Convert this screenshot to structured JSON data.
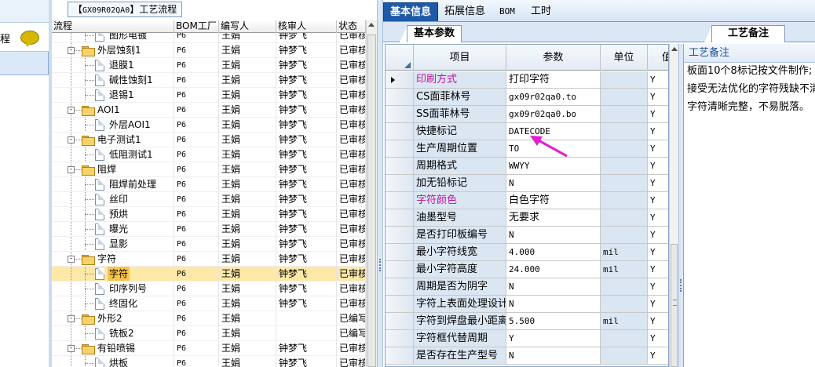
{
  "left_stub": {
    "label": "程"
  },
  "tree": {
    "title_prefix": "【",
    "title_code": "GX09R02QA0",
    "title_suffix": "】工艺流程",
    "columns": [
      "流程",
      "BOM工厂",
      "编写人",
      "核审人",
      "状态"
    ],
    "rows": [
      {
        "name": "图形电镀",
        "bom": "P6",
        "writer": "王娟",
        "reviewer": "钟梦飞",
        "status": "已审核",
        "level": 2,
        "type": "doc"
      },
      {
        "name": "外层蚀刻1",
        "bom": "P6",
        "writer": "王娟",
        "reviewer": "钟梦飞",
        "status": "已审核",
        "level": 1,
        "type": "folder"
      },
      {
        "name": "退膜1",
        "bom": "P6",
        "writer": "王娟",
        "reviewer": "钟梦飞",
        "status": "已审核",
        "level": 2,
        "type": "doc"
      },
      {
        "name": "碱性蚀刻1",
        "bom": "P6",
        "writer": "王娟",
        "reviewer": "钟梦飞",
        "status": "已审核",
        "level": 2,
        "type": "doc"
      },
      {
        "name": "退锡1",
        "bom": "P6",
        "writer": "王娟",
        "reviewer": "钟梦飞",
        "status": "已审核",
        "level": 2,
        "type": "doc"
      },
      {
        "name": "AOI1",
        "bom": "P6",
        "writer": "王娟",
        "reviewer": "钟梦飞",
        "status": "已审核",
        "level": 1,
        "type": "folder"
      },
      {
        "name": "外层AOI1",
        "bom": "P6",
        "writer": "王娟",
        "reviewer": "钟梦飞",
        "status": "已审核",
        "level": 2,
        "type": "doc"
      },
      {
        "name": "电子测试1",
        "bom": "P6",
        "writer": "王娟",
        "reviewer": "钟梦飞",
        "status": "已审核",
        "level": 1,
        "type": "folder"
      },
      {
        "name": "低阻测试1",
        "bom": "P6",
        "writer": "王娟",
        "reviewer": "钟梦飞",
        "status": "已审核",
        "level": 2,
        "type": "doc"
      },
      {
        "name": "阻焊",
        "bom": "P6",
        "writer": "王娟",
        "reviewer": "钟梦飞",
        "status": "已审核",
        "level": 1,
        "type": "folder"
      },
      {
        "name": "阻焊前处理",
        "bom": "P6",
        "writer": "王娟",
        "reviewer": "钟梦飞",
        "status": "已审核",
        "level": 2,
        "type": "doc"
      },
      {
        "name": "丝印",
        "bom": "P6",
        "writer": "王娟",
        "reviewer": "钟梦飞",
        "status": "已审核",
        "level": 2,
        "type": "doc"
      },
      {
        "name": "预烘",
        "bom": "P6",
        "writer": "王娟",
        "reviewer": "钟梦飞",
        "status": "已审核",
        "level": 2,
        "type": "doc"
      },
      {
        "name": "曝光",
        "bom": "P6",
        "writer": "王娟",
        "reviewer": "钟梦飞",
        "status": "已审核",
        "level": 2,
        "type": "doc"
      },
      {
        "name": "显影",
        "bom": "P6",
        "writer": "王娟",
        "reviewer": "钟梦飞",
        "status": "已审核",
        "level": 2,
        "type": "doc"
      },
      {
        "name": "字符",
        "bom": "P6",
        "writer": "王娟",
        "reviewer": "钟梦飞",
        "status": "已审核",
        "level": 1,
        "type": "folder"
      },
      {
        "name": "字符",
        "bom": "P6",
        "writer": "王娟",
        "reviewer": "钟梦飞",
        "status": "已审核",
        "level": 2,
        "type": "doc",
        "selected": true
      },
      {
        "name": "印序列号",
        "bom": "P6",
        "writer": "王娟",
        "reviewer": "钟梦飞",
        "status": "已审核",
        "level": 2,
        "type": "doc"
      },
      {
        "name": "终固化",
        "bom": "P6",
        "writer": "王娟",
        "reviewer": "钟梦飞",
        "status": "已审核",
        "level": 2,
        "type": "doc"
      },
      {
        "name": "外形2",
        "bom": "P6",
        "writer": "王娟",
        "reviewer": "",
        "status": "已编写",
        "level": 1,
        "type": "folder"
      },
      {
        "name": "铣板2",
        "bom": "P6",
        "writer": "王娟",
        "reviewer": "",
        "status": "已编写",
        "level": 2,
        "type": "doc"
      },
      {
        "name": "有铅喷锡",
        "bom": "P6",
        "writer": "王娟",
        "reviewer": "钟梦飞",
        "status": "已审核",
        "level": 1,
        "type": "folder"
      },
      {
        "name": "烘板",
        "bom": "P6",
        "writer": "王娟",
        "reviewer": "钟梦飞",
        "status": "已审核",
        "level": 2,
        "type": "doc"
      }
    ]
  },
  "top_tabs": [
    {
      "label": "基本信息",
      "active": true
    },
    {
      "label": "拓展信息",
      "active": false
    },
    {
      "label": "BOM",
      "active": false
    },
    {
      "label": "工时",
      "active": false
    }
  ],
  "sub_tabs": {
    "params": "基本参数",
    "notes": "工艺备注"
  },
  "params": {
    "columns": [
      "项目",
      "参数",
      "单位",
      "值"
    ],
    "rows": [
      {
        "item": "印刷方式",
        "value": "打印字符",
        "unit": "",
        "flag": "Y",
        "magenta": true,
        "current": true
      },
      {
        "item": "CS面菲林号",
        "value": "gx09r02qa0.to",
        "unit": "",
        "flag": "Y"
      },
      {
        "item": "SS面菲林号",
        "value": "gx09r02qa0.bo",
        "unit": "",
        "flag": "Y"
      },
      {
        "item": "快捷标记",
        "value": "DATECODE",
        "unit": "",
        "flag": "Y"
      },
      {
        "item": "生产周期位置",
        "value": "TO",
        "unit": "",
        "flag": "Y"
      },
      {
        "item": "周期格式",
        "value": "WWYY",
        "unit": "",
        "flag": "Y"
      },
      {
        "item": "加无铅标记",
        "value": "N",
        "unit": "",
        "flag": "Y"
      },
      {
        "item": "字符颜色",
        "value": "白色字符",
        "unit": "",
        "flag": "Y",
        "magenta": true
      },
      {
        "item": "油墨型号",
        "value": "无要求",
        "unit": "",
        "flag": "Y"
      },
      {
        "item": "是否打印板编号",
        "value": "N",
        "unit": "",
        "flag": "Y"
      },
      {
        "item": "最小字符线宽",
        "value": "4.000",
        "unit": "mil",
        "flag": "Y"
      },
      {
        "item": "最小字符高度",
        "value": "24.000",
        "unit": "mil",
        "flag": "Y"
      },
      {
        "item": "周期是否为阴字",
        "value": "N",
        "unit": "",
        "flag": "Y"
      },
      {
        "item": "字符上表面处理设计",
        "value": "N",
        "unit": "",
        "flag": "Y"
      },
      {
        "item": "字符到焊盘最小距离",
        "value": "5.500",
        "unit": "mil",
        "flag": "Y"
      },
      {
        "item": "字符框代替周期",
        "value": "Y",
        "unit": "",
        "flag": "Y"
      },
      {
        "item": "是否存在生产型号",
        "value": "N",
        "unit": "",
        "flag": "Y"
      }
    ]
  },
  "notes": {
    "header": "工艺备注",
    "lines": [
      "板面10个8标记按文件制作;",
      "接受无法优化的字符残缺不清",
      "字符清晰完整，不易脱落。"
    ]
  },
  "colors": {
    "active_tab": "#1e5aa8",
    "magenta_label": "#c0139b",
    "annotation_arrow": "#e020d0",
    "selected_row": "#fde8a8"
  }
}
